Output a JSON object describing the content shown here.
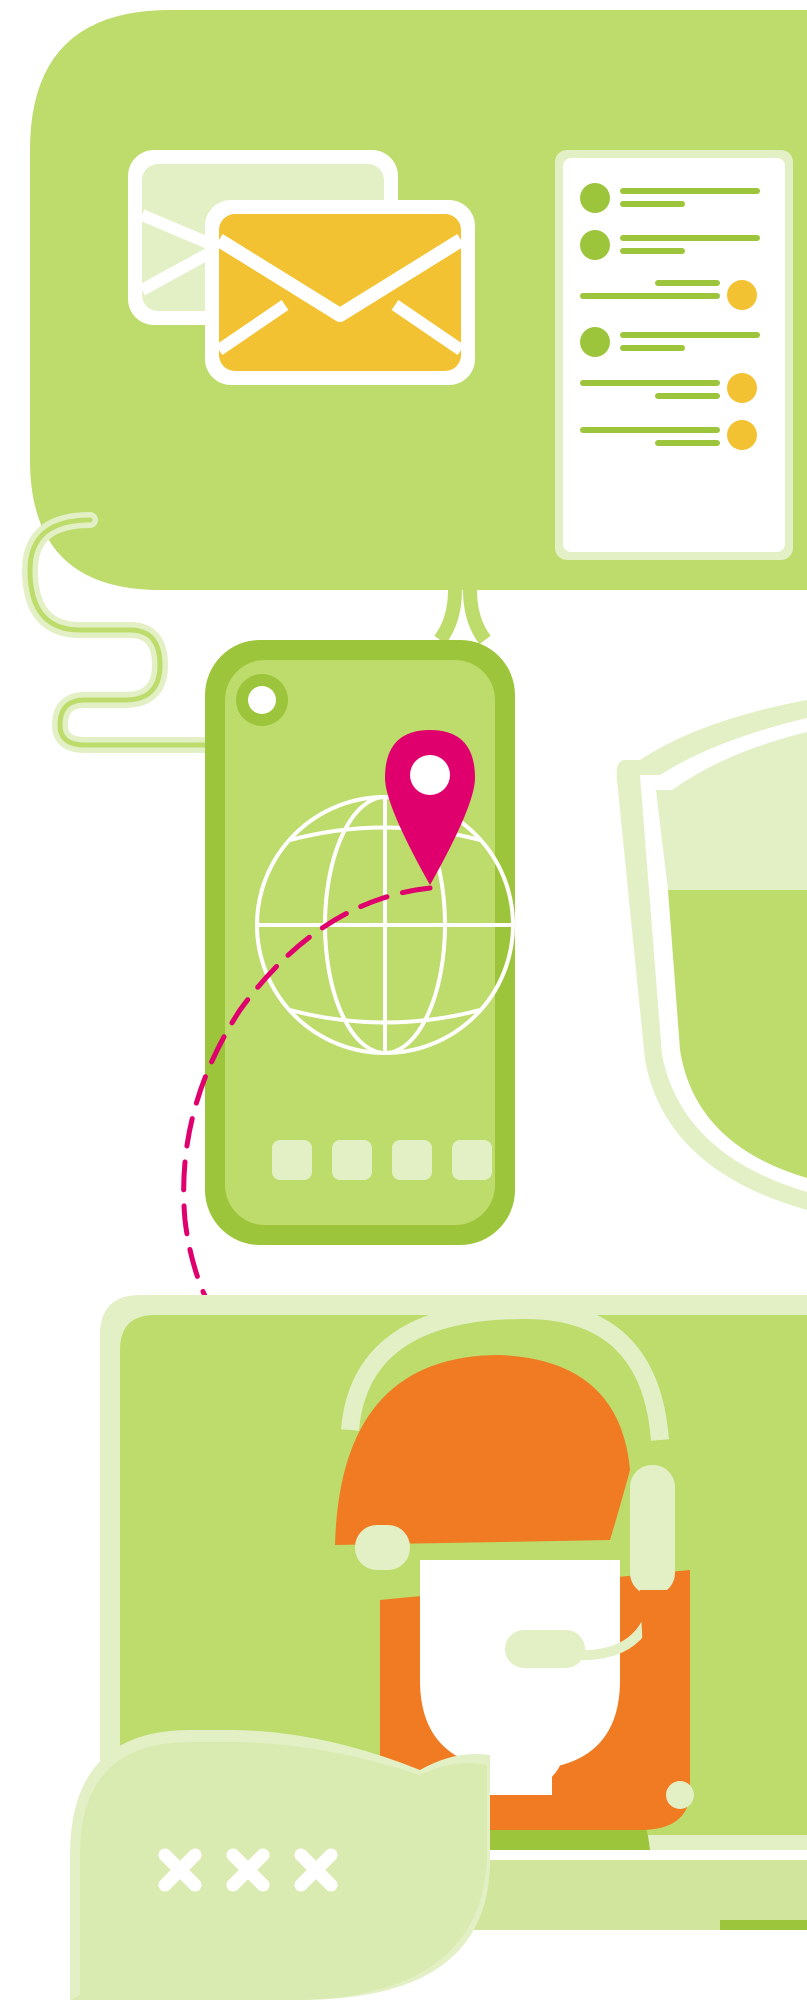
{
  "illustration": {
    "palette": {
      "green_light": "#bddc6c",
      "green_mid": "#9dc53b",
      "green_pale": "#e3f0c6",
      "green_paler": "#d1e69c",
      "yellow": "#f3c232",
      "orange": "#f07b23",
      "magenta": "#e0006d",
      "white": "#ffffff",
      "skin": "#ffffff"
    },
    "icons": [
      "speech-bubble-icon",
      "envelope-icon",
      "chat-panel-icon",
      "smartphone-icon",
      "globe-icon",
      "location-pin-icon",
      "shield-icon",
      "support-agent-icon",
      "headset-icon",
      "password-bubble-icon"
    ],
    "chat_messages": [
      {
        "side": "left"
      },
      {
        "side": "left"
      },
      {
        "side": "right"
      },
      {
        "side": "left"
      },
      {
        "side": "right"
      },
      {
        "side": "right"
      }
    ],
    "phone_dock_buttons": 4,
    "password_mask_count": 3
  }
}
